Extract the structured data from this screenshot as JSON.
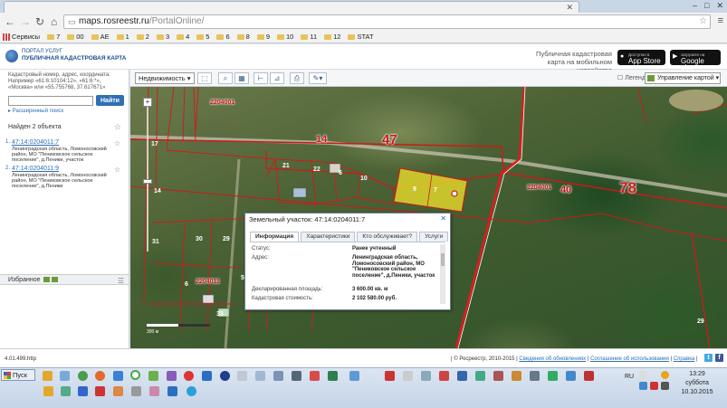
{
  "browser": {
    "url_host": "maps.rosreestr.ru",
    "url_path": "/PortalOnline/",
    "bookmarks": [
      "Сервисы",
      "7",
      "00",
      "AE",
      "1",
      "2",
      "3",
      "4",
      "5",
      "6",
      "8",
      "9",
      "10",
      "11",
      "12",
      "STAT"
    ]
  },
  "header": {
    "logo_line1": "ПОРТАЛ УСЛУГ",
    "logo_line2": "ПУБЛИЧНАЯ КАДАСТРОВАЯ КАРТА",
    "mobile_text": "Публичная кадастровая карта на мобильном устройстве",
    "appstore_small": "Доступно в",
    "appstore": "App Store",
    "googleplay_small": "загрузите на",
    "googleplay": "Google play"
  },
  "search": {
    "label": "Кадастровый номер, адрес, координата: Например «61:6:10104:12», «61:6:*», «Москва» или «55.755768, 37.617671»",
    "value": "",
    "button": "Найти",
    "advanced": "▸ Расширенный поиск"
  },
  "results": {
    "found": "Найден 2 объекта",
    "items": [
      {
        "num": "1.",
        "id": "47:14:0204011:7",
        "address": "Ленинградская область, Ломоносовский район, МО \"Пениковское сельское поселение\", д.Пеники, участок"
      },
      {
        "num": "2.",
        "id": "47:14:0204011:9",
        "address": "Ленинградская область, Ломоносовский район, МО \"Пениковское сельское поселение\", д.Пеники"
      }
    ]
  },
  "favorites": {
    "label": "Избранное"
  },
  "maptools": {
    "layer": "Недвижимость",
    "legend": "Легенда",
    "manage": "Управление картой"
  },
  "map": {
    "labels": {
      "n14": "14",
      "n47": "47",
      "n40": "40",
      "n78": "78",
      "q1": "2204001",
      "q2": "2204001",
      "q3": "2204011",
      "p17": "17",
      "p14": "14",
      "p21": "21",
      "p22": "22",
      "p6": "6",
      "p10": "10",
      "p9": "9",
      "p7": "7",
      "p31": "31",
      "p30": "30",
      "p29": "29",
      "p33": "33",
      "p5": "5",
      "p6b": "6",
      "p29b": "29"
    },
    "scale": "300 м"
  },
  "popup": {
    "title": "Земельный участок: 47:14:0204011:7",
    "tabs": [
      "Информация",
      "Характеристики",
      "Кто обслуживает?",
      "Услуги"
    ],
    "rows": [
      {
        "k": "Статус:",
        "v": "Ранее учтенный"
      },
      {
        "k": "Адрес:",
        "v": "Ленинградская область, Ломоносовский район, МО \"Пениковское сельское поселение\", д.Пеники, участок"
      },
      {
        "k": "Декларированная площадь:",
        "v": "3 600.00 кв. м"
      },
      {
        "k": "Кадастровая стоимость:",
        "v": "2 102 580.00 руб."
      }
    ]
  },
  "footer": {
    "version": "4.01.499.http",
    "copyright": "| © Росреестр, 2010-2015 |",
    "updates": "Сведения об обновлениях",
    "agreement": "Соглашение об использовании",
    "help": "Справка"
  },
  "taskbar": {
    "start": "Пуск",
    "lang": "RU",
    "time": "13:29",
    "day": "суббота",
    "date": "10.10.2015"
  },
  "colors": {
    "boundary": "#cc1a1a",
    "selected_parcel": "#f3e42a",
    "link": "#2e6fb5"
  }
}
